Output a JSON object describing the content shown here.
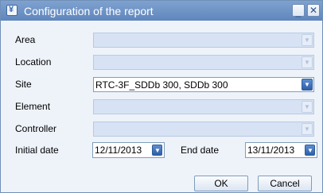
{
  "window": {
    "title": "Configuration of the report",
    "app_icon": "report-icon",
    "icon_glyph": "¥",
    "minimize_glyph": "_",
    "close_glyph": "✕"
  },
  "fields": {
    "area": {
      "label": "Area",
      "value": ""
    },
    "location": {
      "label": "Location",
      "value": ""
    },
    "site": {
      "label": "Site",
      "value": "RTC-3F_SDDb 300, SDDb 300"
    },
    "element": {
      "label": "Element",
      "value": ""
    },
    "controller": {
      "label": "Controller",
      "value": ""
    }
  },
  "dates": {
    "initial_label": "Initial date",
    "initial_value": "12/11/2013",
    "end_label": "End date",
    "end_value": "13/11/2013"
  },
  "dropdown_glyph": "▼",
  "buttons": {
    "ok": "OK",
    "cancel": "Cancel"
  },
  "colors": {
    "titlebar": "#6f93c6",
    "panel": "#eef3fa",
    "disabled_field": "#d7e3f4",
    "accent": "#2e5fa8"
  }
}
